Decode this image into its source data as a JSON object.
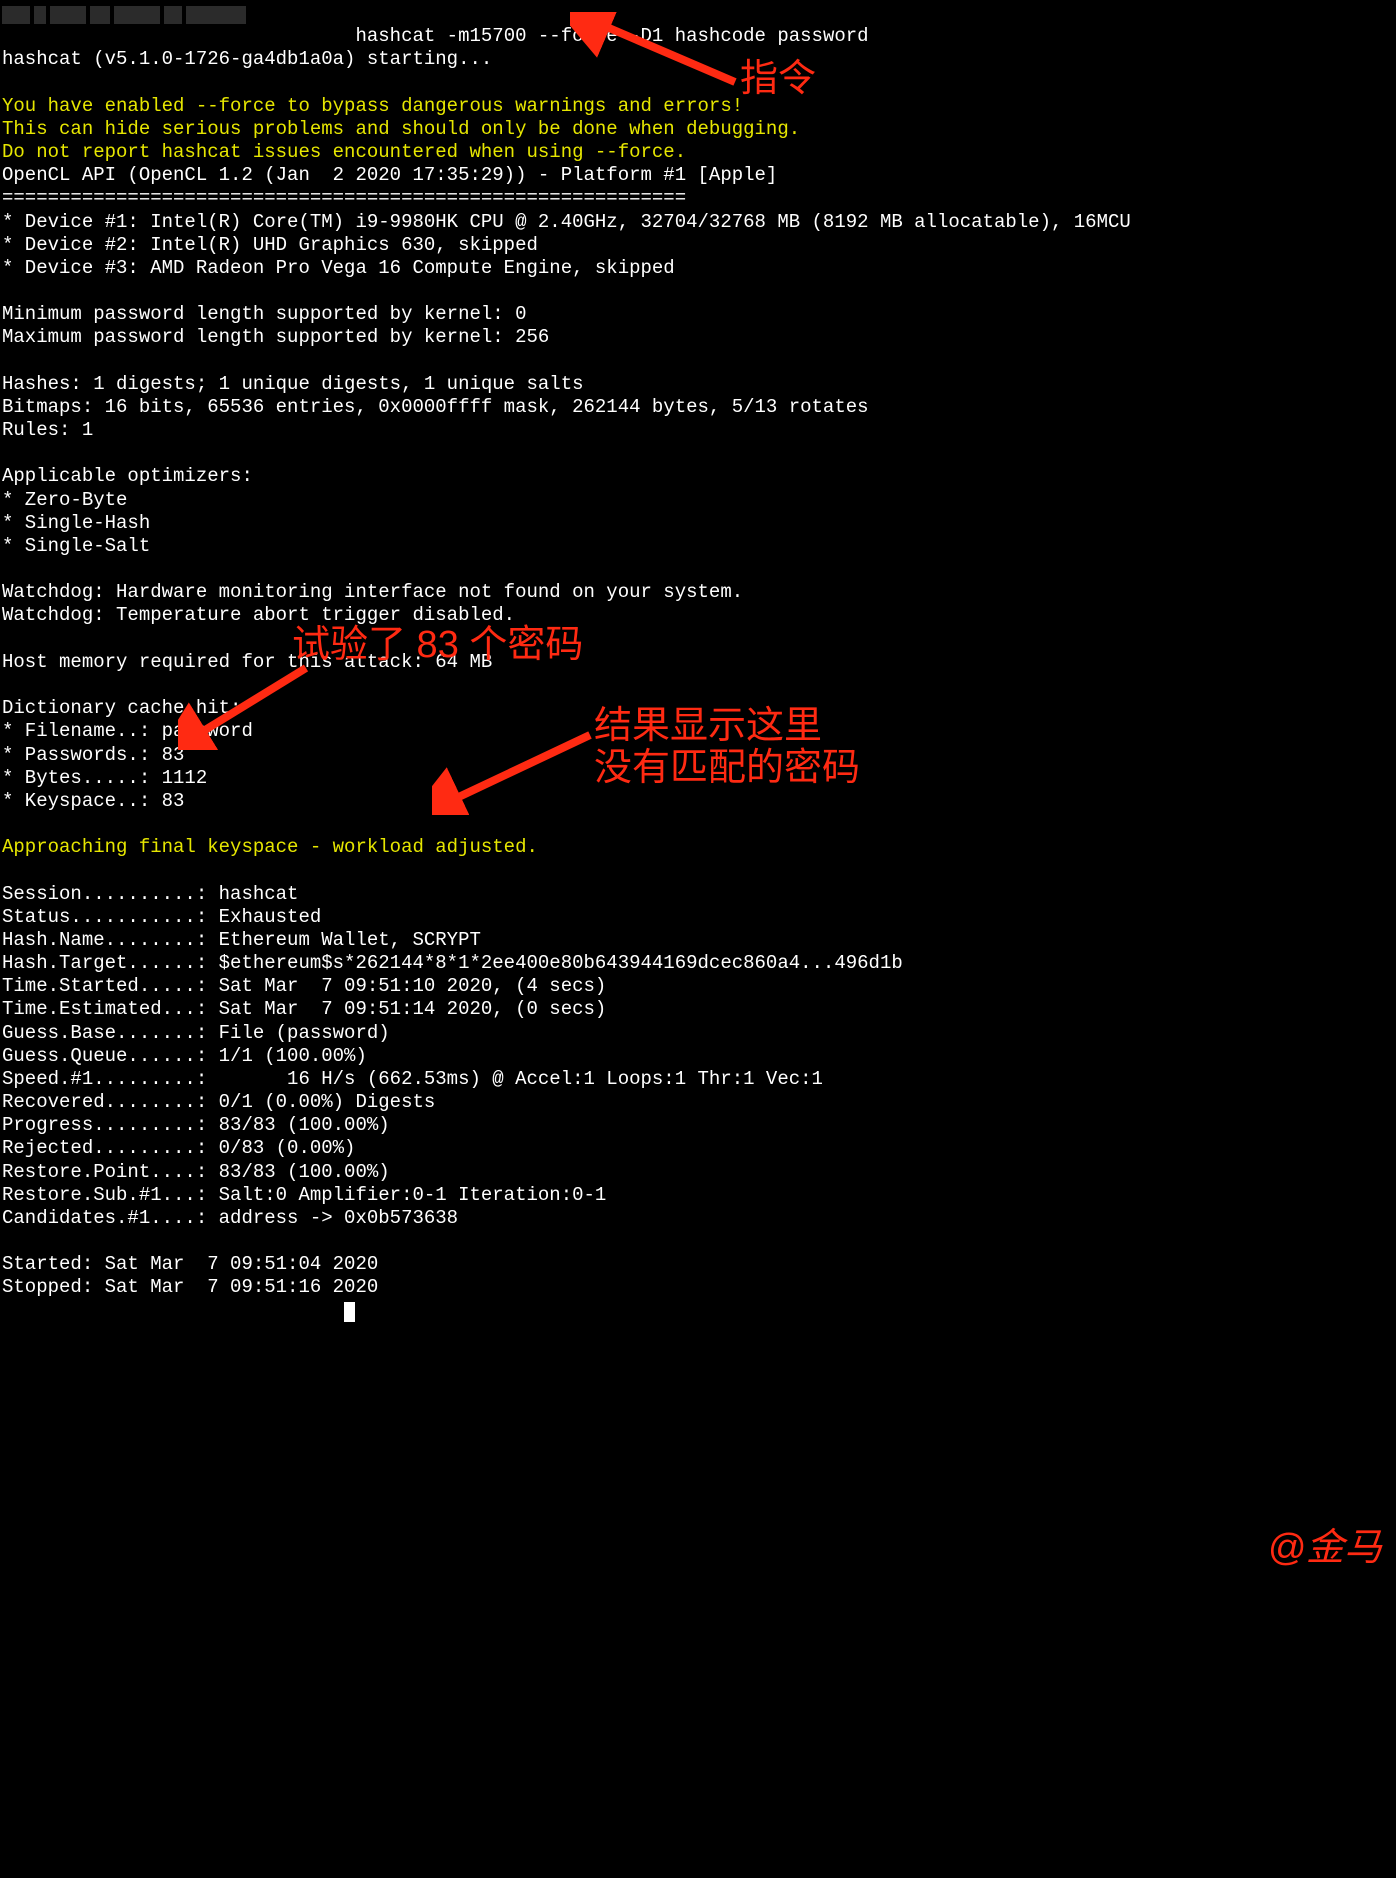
{
  "prompt_cmd": "hashcat -m15700 --force -D1 hashcode password",
  "starting": "hashcat (v5.1.0-1726-ga4db1a0a) starting...",
  "warn": [
    "You have enabled --force to bypass dangerous warnings and errors!",
    "This can hide serious problems and should only be done when debugging.",
    "Do not report hashcat issues encountered when using --force."
  ],
  "platform": "OpenCL API (OpenCL 1.2 (Jan  2 2020 17:35:29)) - Platform #1 [Apple]",
  "hr": "============================================================",
  "devices": [
    "* Device #1: Intel(R) Core(TM) i9-9980HK CPU @ 2.40GHz, 32704/32768 MB (8192 MB allocatable), 16MCU",
    "* Device #2: Intel(R) UHD Graphics 630, skipped",
    "* Device #3: AMD Radeon Pro Vega 16 Compute Engine, skipped"
  ],
  "minmax": [
    "Minimum password length supported by kernel: 0",
    "Maximum password length supported by kernel: 256"
  ],
  "hash_info": [
    "Hashes: 1 digests; 1 unique digests, 1 unique salts",
    "Bitmaps: 16 bits, 65536 entries, 0x0000ffff mask, 262144 bytes, 5/13 rotates",
    "Rules: 1"
  ],
  "opt_title": "Applicable optimizers:",
  "opts": [
    "* Zero-Byte",
    "* Single-Hash",
    "* Single-Salt"
  ],
  "watchdog": [
    "Watchdog: Hardware monitoring interface not found on your system.",
    "Watchdog: Temperature abort trigger disabled."
  ],
  "hostmem": "Host memory required for this attack: 64 MB",
  "cache_hit": "Dictionary cache hit:",
  "cache": [
    "* Filename..: password",
    "* Passwords.: 83",
    "* Bytes.....: 1112",
    "* Keyspace..: 83"
  ],
  "approach": "Approaching final keyspace - workload adjusted.",
  "status": [
    "Session..........: hashcat",
    "Status...........: Exhausted",
    "Hash.Name........: Ethereum Wallet, SCRYPT",
    "Hash.Target......: $ethereum$s*262144*8*1*2ee400e80b643944169dcec860a4...496d1b",
    "Time.Started.....: Sat Mar  7 09:51:10 2020, (4 secs)",
    "Time.Estimated...: Sat Mar  7 09:51:14 2020, (0 secs)",
    "Guess.Base.......: File (password)",
    "Guess.Queue......: 1/1 (100.00%)",
    "Speed.#1.........:       16 H/s (662.53ms) @ Accel:1 Loops:1 Thr:1 Vec:1",
    "Recovered........: 0/1 (0.00%) Digests",
    "Progress.........: 83/83 (100.00%)",
    "Rejected.........: 0/83 (0.00%)",
    "Restore.Point....: 83/83 (100.00%)",
    "Restore.Sub.#1...: Salt:0 Amplifier:0-1 Iteration:0-1",
    "Candidates.#1....: address -> 0x0b573638"
  ],
  "times": [
    "Started: Sat Mar  7 09:51:04 2020",
    "Stopped: Sat Mar  7 09:51:16 2020"
  ],
  "annotations": {
    "cmd": "指令",
    "tried": "试验了 83 个密码",
    "result": "结果显示这里\n没有匹配的密码",
    "sig": "@金马"
  }
}
